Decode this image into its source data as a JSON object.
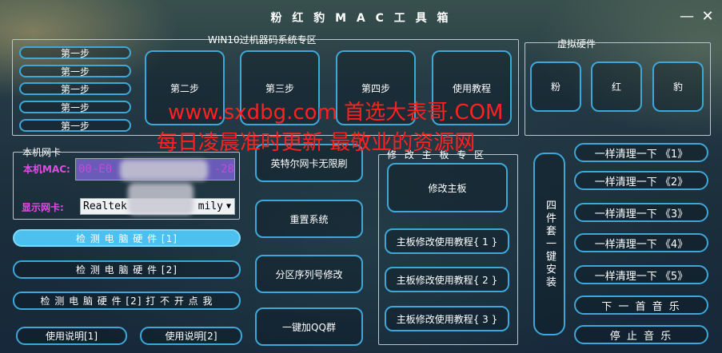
{
  "window": {
    "title": "粉 红 豹 M A C 工 具 箱",
    "minimize": "—",
    "close": "✕"
  },
  "win10_group": {
    "title": "WIN10过机器码系统专区",
    "step1_buttons": [
      "第一步",
      "第一步",
      "第一步",
      "第一步",
      "第一步"
    ],
    "step2": "第二步",
    "step3": "第三步",
    "step4": "第四步",
    "tutorial": "使用教程"
  },
  "virtual_group": {
    "title": "虚拟硬件",
    "buttons": [
      "粉",
      "红",
      "豹"
    ]
  },
  "watermark": {
    "line1": "www.sxdbg.com  首选大表哥.COM",
    "line2": "每日凌晨准时更新   最敬业的资源网"
  },
  "nic_group": {
    "title": "本机网卡",
    "mac_label": "本机MAC:",
    "mac_value_start": "00-E0",
    "mac_value_end": "-28",
    "nic_label": "显示网卡:",
    "nic_value_start": "Realtek",
    "nic_value_end": "mily"
  },
  "detect": {
    "btn1": "检 测 电 脑 硬 件 [1]",
    "btn2": "检 测 电 脑 硬 件 [2]",
    "btn3": "检 测 电 脑 硬 件 [2] 打 不 开 点 我",
    "help1": "使用说明[1]",
    "help2": "使用说明[2]"
  },
  "middle": {
    "intel": "英特尔网卡无限刷",
    "reset": "重置系统",
    "partition": "分区序列号修改",
    "qq": "一键加QQ群"
  },
  "board_group": {
    "title": "修 改 主 板 专 区",
    "modify": "修改主板",
    "tut1": "主板修改使用教程{ 1 }",
    "tut2": "主板修改使用教程{ 2 }",
    "tut3": "主板修改使用教程{ 3 }",
    "four_install": "四件套一键安装"
  },
  "clean": {
    "items": [
      "一样清理一下 《1》",
      "一样清理一下 《2》",
      "一样清理一下 《3》",
      "一样清理一下 《4》",
      "一样清理一下 《5》"
    ],
    "next_music": "下 一 首 音 乐",
    "stop_music": "停 止 音 乐"
  }
}
